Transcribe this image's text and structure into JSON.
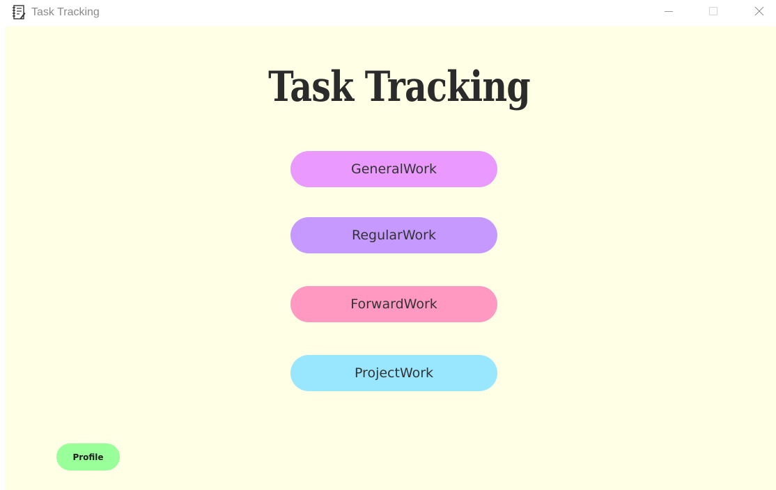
{
  "window": {
    "title": "Task Tracking",
    "icon": "notebook-icon",
    "controls": [
      "minimize-icon",
      "maximize-icon",
      "close-icon"
    ]
  },
  "main": {
    "heading": "Task Tracking",
    "background": "#ffffe6",
    "buttons": [
      {
        "label": "GeneralWork",
        "color": "#ea99ff"
      },
      {
        "label": "RegularWork",
        "color": "#c599ff"
      },
      {
        "label": "ForwardWork",
        "color": "#ff99c2"
      },
      {
        "label": "ProjectWork",
        "color": "#99e6ff"
      }
    ]
  },
  "footer": {
    "profile_label": "Profile",
    "profile_color": "#99ff99"
  }
}
